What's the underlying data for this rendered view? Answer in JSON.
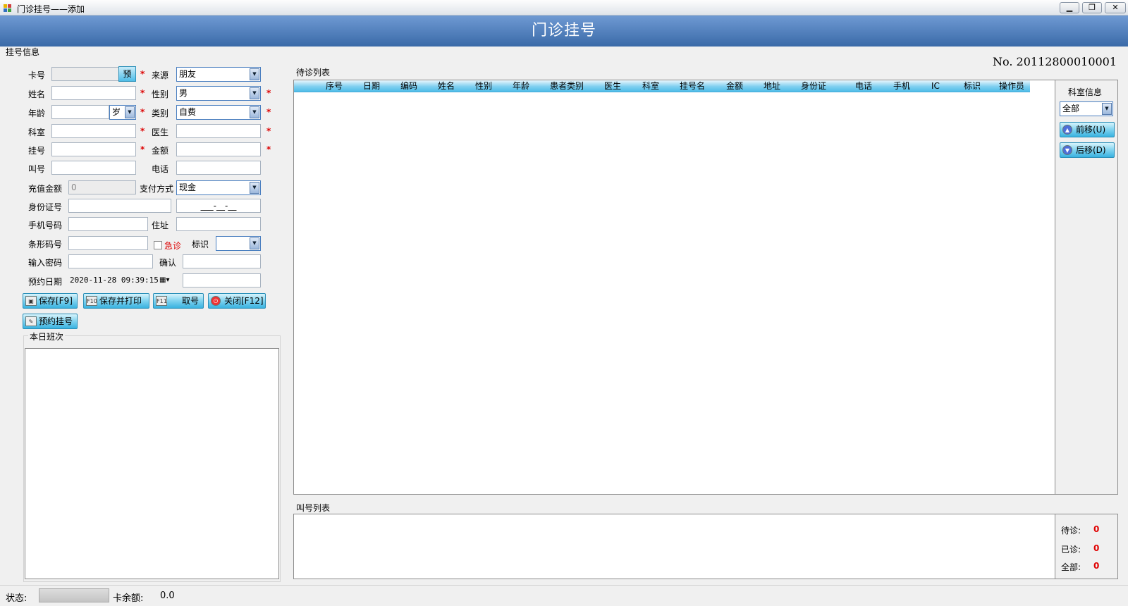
{
  "window": {
    "title": "门诊挂号——添加",
    "min": "▁",
    "max": "❐",
    "close": "✕"
  },
  "banner": {
    "title": "门诊挂号"
  },
  "form": {
    "group_title": "挂号信息",
    "number": "No. 20112800010001",
    "labels": {
      "card": "卡号",
      "source": "来源",
      "name": "姓名",
      "gender": "性别",
      "age": "年龄",
      "category": "类别",
      "dept": "科室",
      "doctor": "医生",
      "reg": "挂号",
      "amount": "金额",
      "call": "叫号",
      "phone": "电话",
      "recharge": "充值金额",
      "pay_method": "支付方式",
      "idcard": "身份证号",
      "mobile": "手机号码",
      "address": "住址",
      "barcode": "条形码号",
      "emergency": "急诊",
      "mark": "标识",
      "password": "输入密码",
      "confirm": "确认",
      "appt_date": "预约日期"
    },
    "values": {
      "source": "朋友",
      "gender": "男",
      "age_unit": "岁",
      "category": "自费",
      "recharge": "0",
      "pay_method": "现金",
      "id_mask": "___-__-__",
      "appt_date": "2020-11-28 09:39:15"
    },
    "pre_button": "预",
    "star": "*"
  },
  "buttons": {
    "save": "保存[F9]",
    "save_print": "保存并打印",
    "take_num": "取号",
    "close": "关闭[F12]",
    "appointment": "预约挂号",
    "f10": "F10",
    "f11": "F11"
  },
  "today_shift": {
    "title": "本日班次"
  },
  "waiting_list": {
    "title": "待诊列表",
    "columns": [
      "序号",
      "日期",
      "编码",
      "姓名",
      "性别",
      "年龄",
      "患者类别",
      "医生",
      "科室",
      "挂号名",
      "金额",
      "地址",
      "身份证",
      "电话",
      "手机",
      "IC",
      "标识",
      "操作员"
    ]
  },
  "dept_panel": {
    "title": "科室信息",
    "select": "全部",
    "prev": "前移(U)",
    "next": "后移(D)"
  },
  "call_list": {
    "title": "叫号列表"
  },
  "counters": [
    {
      "label": "待诊:",
      "value": "0"
    },
    {
      "label": "已诊:",
      "value": "0"
    },
    {
      "label": "全部:",
      "value": "0"
    }
  ],
  "status": {
    "state_label": "状态:",
    "balance_label": "卡余额:",
    "balance": "0.0"
  }
}
